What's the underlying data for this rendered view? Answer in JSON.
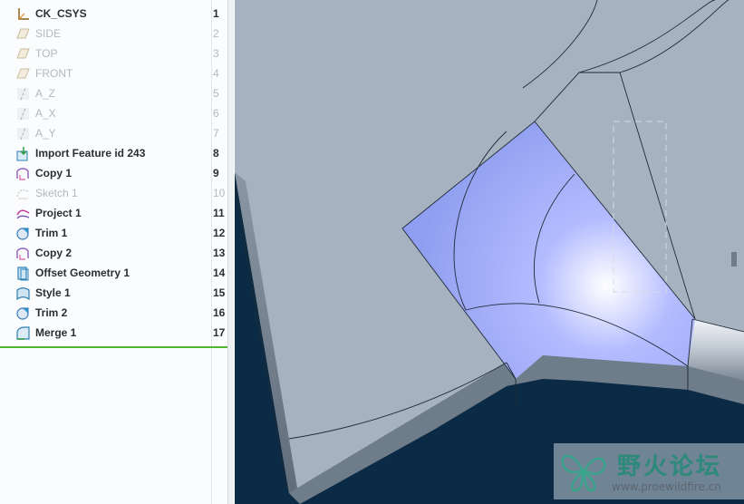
{
  "model_tree": {
    "items": [
      {
        "label": "CK_CSYS",
        "num": "1",
        "icon": "csys-icon",
        "dim": false
      },
      {
        "label": "SIDE",
        "num": "2",
        "icon": "datum-plane-icon",
        "dim": true
      },
      {
        "label": "TOP",
        "num": "3",
        "icon": "datum-plane-icon",
        "dim": true
      },
      {
        "label": "FRONT",
        "num": "4",
        "icon": "datum-plane-icon",
        "dim": true
      },
      {
        "label": "A_Z",
        "num": "5",
        "icon": "datum-axis-icon",
        "dim": true
      },
      {
        "label": "A_X",
        "num": "6",
        "icon": "datum-axis-icon",
        "dim": true
      },
      {
        "label": "A_Y",
        "num": "7",
        "icon": "datum-axis-icon",
        "dim": true
      },
      {
        "label": "Import Feature id 243",
        "num": "8",
        "icon": "import-feature-icon",
        "dim": false
      },
      {
        "label": "Copy 1",
        "num": "9",
        "icon": "copy-surface-icon",
        "dim": false
      },
      {
        "label": "Sketch 1",
        "num": "10",
        "icon": "sketch-icon",
        "dim": true
      },
      {
        "label": "Project 1",
        "num": "11",
        "icon": "project-curve-icon",
        "dim": false
      },
      {
        "label": "Trim 1",
        "num": "12",
        "icon": "trim-icon",
        "dim": false
      },
      {
        "label": "Copy 2",
        "num": "13",
        "icon": "copy-surface-icon",
        "dim": false
      },
      {
        "label": "Offset Geometry 1",
        "num": "14",
        "icon": "offset-geometry-icon",
        "dim": false
      },
      {
        "label": "Style 1",
        "num": "15",
        "icon": "style-icon",
        "dim": false
      },
      {
        "label": "Trim 2",
        "num": "16",
        "icon": "trim-icon",
        "dim": false
      },
      {
        "label": "Merge 1",
        "num": "17",
        "icon": "merge-icon",
        "dim": false
      }
    ]
  },
  "watermark": {
    "title": "野火论坛",
    "url": "www.proewildfire.cn"
  },
  "colors": {
    "part_surface": "#a4b0be",
    "selected_surface": "#aab4ff",
    "background": "#0a2a45",
    "insert_indicator": "#4fb833",
    "watermark_accent": "#2d8a7a"
  }
}
